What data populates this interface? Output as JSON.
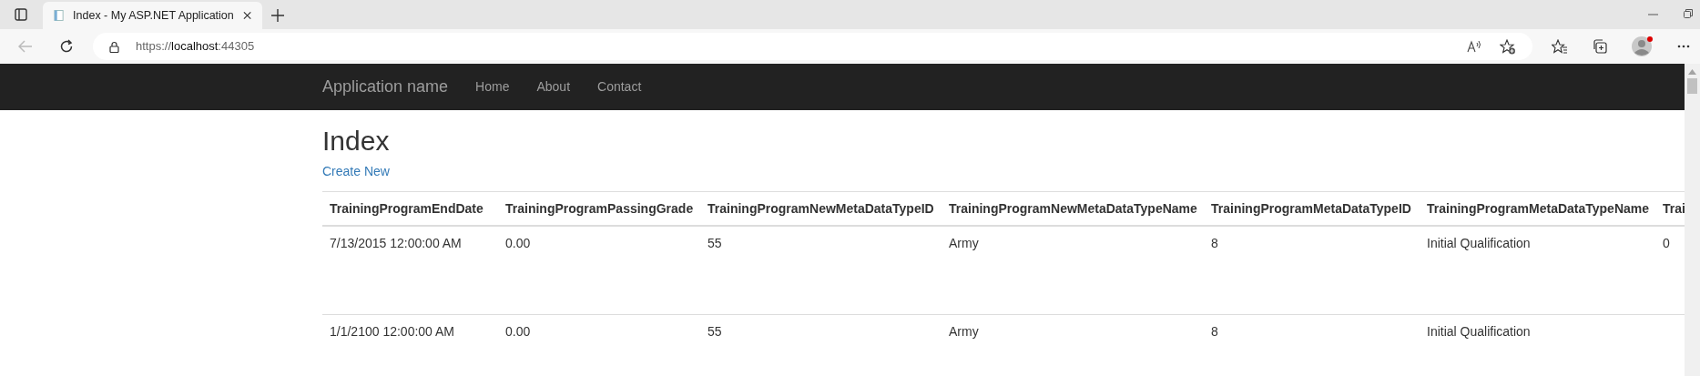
{
  "browser": {
    "tab_title": "Index - My ASP.NET Application",
    "url_prefix": "https://",
    "url_host": "localhost",
    "url_port": ":44305"
  },
  "navbar": {
    "brand": "Application name",
    "links": [
      "Home",
      "About",
      "Contact"
    ]
  },
  "page": {
    "heading": "Index",
    "create_link": "Create New"
  },
  "table": {
    "columns": [
      "TrainingProgramEndDate",
      "TrainingProgramPassingGrade",
      "TrainingProgramNewMetaDataTypeID",
      "TrainingProgramNewMetaDataTypeName",
      "TrainingProgramMetaDataTypeID",
      "TrainingProgramMetaDataTypeName",
      "Trai"
    ],
    "rows": [
      [
        "7/13/2015 12:00:00 AM",
        "0.00",
        "55",
        "Army",
        "8",
        "Initial Qualification",
        "0"
      ],
      [
        "1/1/2100 12:00:00 AM",
        "0.00",
        "55",
        "Army",
        "8",
        "Initial Qualification",
        ""
      ]
    ]
  }
}
